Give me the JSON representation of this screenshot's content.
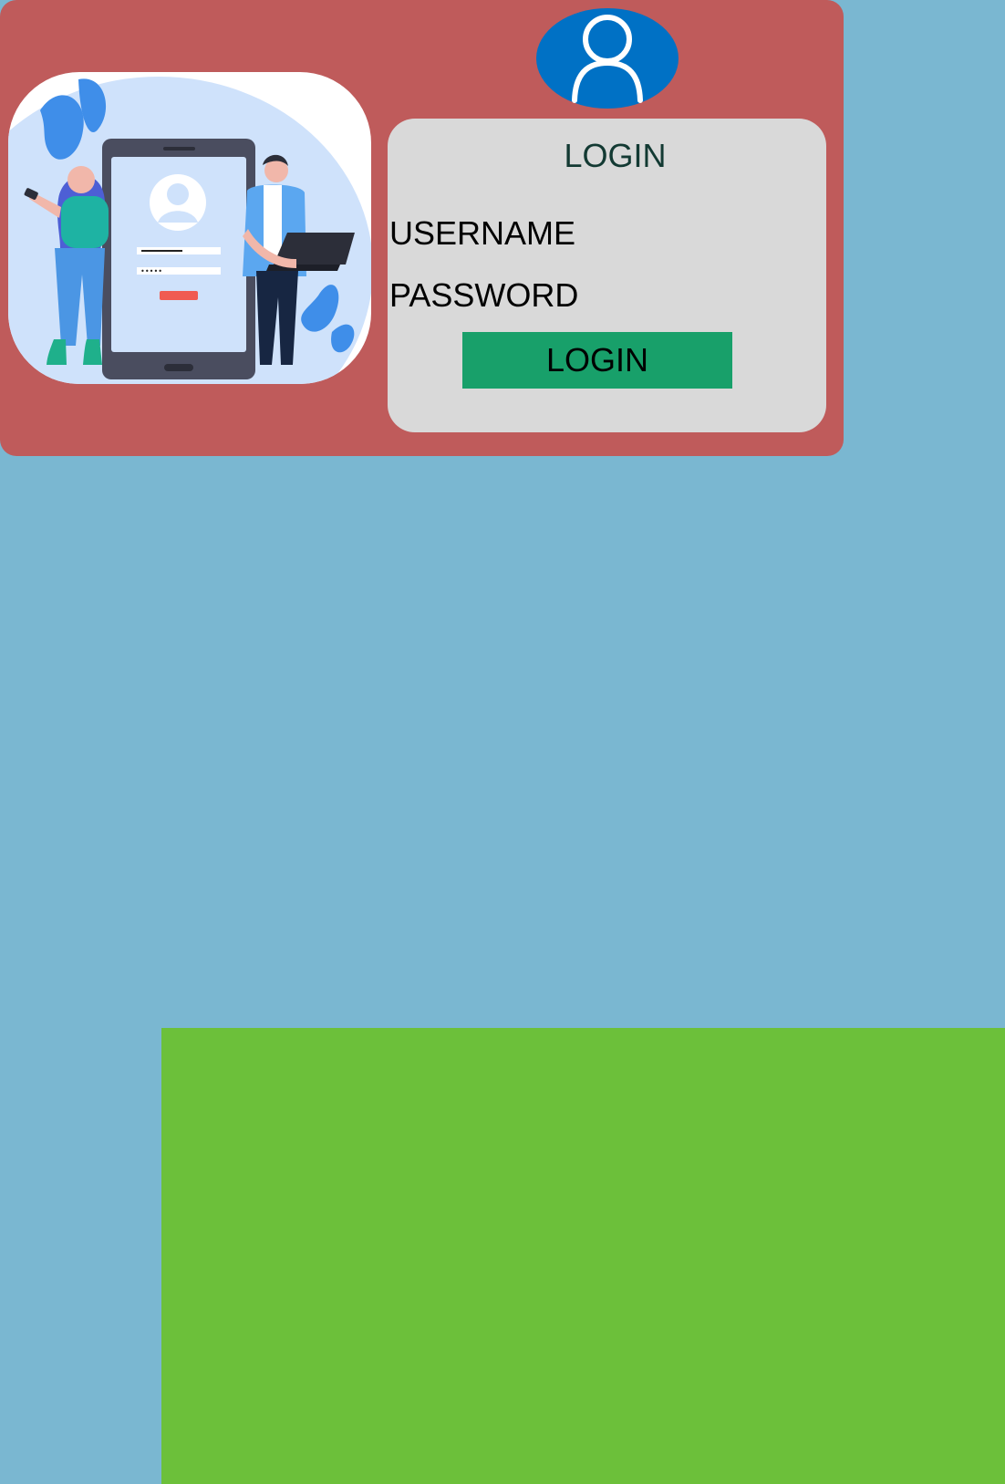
{
  "login_card": {
    "title": "LOGIN",
    "username_label": "USERNAME",
    "password_label": "PASSWORD",
    "login_button_label": "LOGIN",
    "avatar_icon": "user-avatar-icon",
    "illustration_icon": "mobile-login-illustration"
  },
  "colors": {
    "page_background": "#7ab7d1",
    "card_background": "#bf5b5b",
    "form_background": "#d9d9d9",
    "avatar_background": "#0071c5",
    "button_background": "#18a06a",
    "bottom_panel": "#6cc03a"
  }
}
